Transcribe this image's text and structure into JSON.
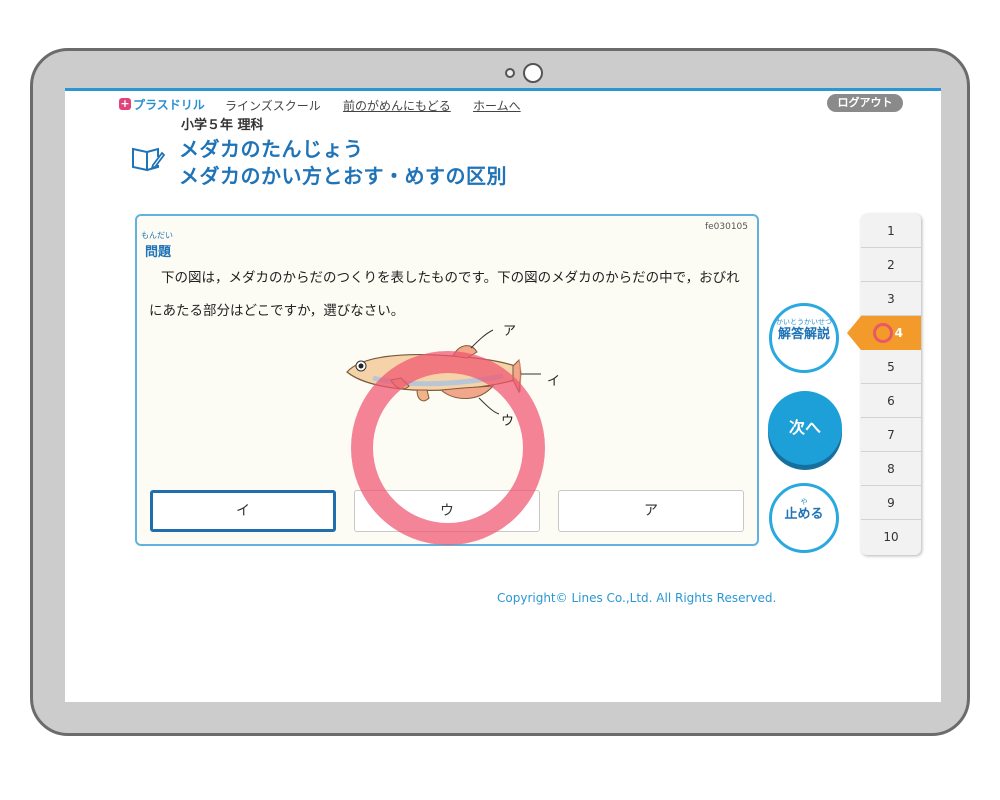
{
  "header": {
    "logo_mark": "+",
    "logo_text": "プラスドリル",
    "school": "ラインズスクール",
    "back_link": "前のがめんにもどる",
    "home_link": "ホームへ",
    "logout": "ログアウト"
  },
  "course": {
    "grade": "小学５年 理科",
    "title_line1": "メダカのたんじょう",
    "title_line2": "メダカのかい方とおす・めすの区別"
  },
  "question": {
    "id": "fe030105",
    "label_ruby": "もんだい",
    "label": "問題",
    "text": "下の図は，メダカのからだのつくりを表したものです。下の図のメダカのからだの中で，おびれにあたる部分はどこですか，選びなさい。",
    "figure_labels": {
      "a": "ア",
      "i": "イ",
      "u": "ウ"
    },
    "choices": [
      {
        "label": "イ",
        "selected": true
      },
      {
        "label": "ウ",
        "selected": false
      },
      {
        "label": "ア",
        "selected": false
      }
    ]
  },
  "side": {
    "explain_ruby": "かいとうかいせつ",
    "explain_label": "解答解説",
    "next_label": "次へ",
    "stop_ruby": "や",
    "stop_label": "止める"
  },
  "pagination": {
    "items": [
      "1",
      "2",
      "3",
      "4",
      "5",
      "6",
      "7",
      "8",
      "9",
      "10"
    ],
    "current": 4
  },
  "footer": {
    "copyright": "Copyright© Lines Co.,Ltd. All Rights Reserved."
  },
  "colors": {
    "accent": "#2a97d3",
    "title": "#1f73b7",
    "active_page": "#f29a2a",
    "correct_mark": "#f05470"
  }
}
